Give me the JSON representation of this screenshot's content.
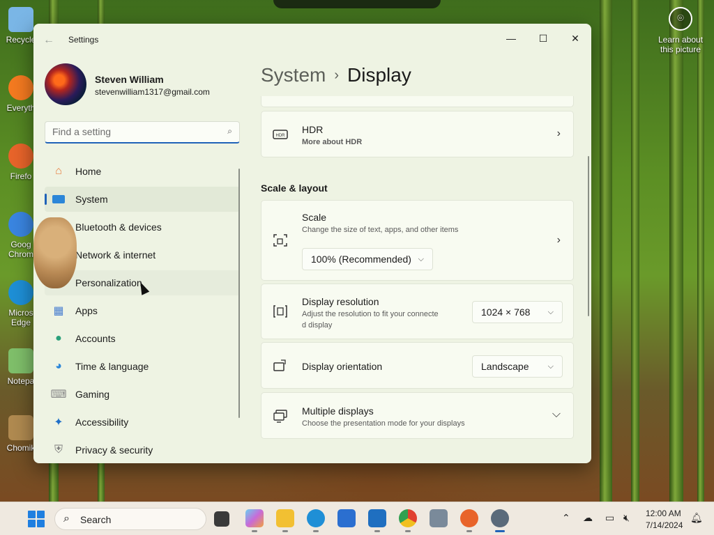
{
  "desktop": {
    "icons": [
      {
        "label": "Recycle",
        "color": "#7ab6e6"
      },
      {
        "label": "Everyth",
        "color": "#f47a20"
      },
      {
        "label": "Firefo",
        "color": "#e8642a"
      },
      {
        "label": "Goog Chrom",
        "color": "#3a85e0"
      },
      {
        "label": "Micros Edge",
        "color": "#1e8fd6"
      },
      {
        "label": "Notepa",
        "color": "#7fbf6a"
      },
      {
        "label": "Chomik",
        "color": "#b08a50"
      }
    ],
    "learn_line1": "Learn about",
    "learn_line2": "this picture"
  },
  "window": {
    "title": "Settings",
    "back_glyph": "←",
    "minimize_glyph": "—",
    "maximize_glyph": "☐",
    "close_glyph": "✕"
  },
  "user": {
    "name": "Steven William",
    "email": "stevenwilliam1317@gmail.com"
  },
  "search": {
    "placeholder": "Find a setting"
  },
  "nav": {
    "items": [
      {
        "label": "Home",
        "icon": "home-icon",
        "color": "#e87a3a"
      },
      {
        "label": "System",
        "icon": "system-icon",
        "color": "#2b86d8"
      },
      {
        "label": "Bluetooth & devices",
        "icon": "bluetooth-icon",
        "color": "#2b86d8"
      },
      {
        "label": "Network & internet",
        "icon": "network-icon",
        "color": "#2b86d8"
      },
      {
        "label": "Personalization",
        "icon": "brush-icon",
        "color": "#d88a3a"
      },
      {
        "label": "Apps",
        "icon": "apps-icon",
        "color": "#4a7fd0"
      },
      {
        "label": "Accounts",
        "icon": "accounts-icon",
        "color": "#2aa07a"
      },
      {
        "label": "Time & language",
        "icon": "globe-icon",
        "color": "#2b86d8"
      },
      {
        "label": "Gaming",
        "icon": "gamepad-icon",
        "color": "#8a8a8a"
      },
      {
        "label": "Accessibility",
        "icon": "accessibility-icon",
        "color": "#1f6fc8"
      },
      {
        "label": "Privacy & security",
        "icon": "shield-icon",
        "color": "#7a7a7a"
      }
    ]
  },
  "main": {
    "breadcrumb_parent": "System",
    "breadcrumb_sep": "›",
    "breadcrumb_current": "Display",
    "hdr": {
      "title": "HDR",
      "link": "More about HDR"
    },
    "section_title": "Scale & layout",
    "scale": {
      "title": "Scale",
      "subtitle": "Change the size of text, apps, and other items",
      "value": "100% (Recommended)"
    },
    "resolution": {
      "title": "Display resolution",
      "subtitle_line1": "Adjust the resolution to fit your connecte",
      "subtitle_line2": "d display",
      "value": "1024 × 768"
    },
    "orientation": {
      "title": "Display orientation",
      "value": "Landscape"
    },
    "multiple": {
      "title": "Multiple displays",
      "subtitle": "Choose the presentation mode for your displays"
    }
  },
  "taskbar": {
    "search_label": "Search",
    "time": "12:00 AM",
    "date": "7/14/2024",
    "apps": [
      {
        "name": "task-view-icon",
        "color": "#3a3a3a"
      },
      {
        "name": "copilot-icon",
        "color": "#c86ad8"
      },
      {
        "name": "file-explorer-icon",
        "color": "#f2c032"
      },
      {
        "name": "edge-icon",
        "color": "#1f8fd6"
      },
      {
        "name": "store-icon",
        "color": "#2b6fd0"
      },
      {
        "name": "outlook-icon",
        "color": "#1f6fc0"
      },
      {
        "name": "chrome-icon",
        "color": "#e0a020"
      },
      {
        "name": "app-icon",
        "color": "#7a8a9a"
      },
      {
        "name": "firefox-icon",
        "color": "#e8642a"
      },
      {
        "name": "settings-icon",
        "color": "#5a6a7a"
      }
    ]
  }
}
